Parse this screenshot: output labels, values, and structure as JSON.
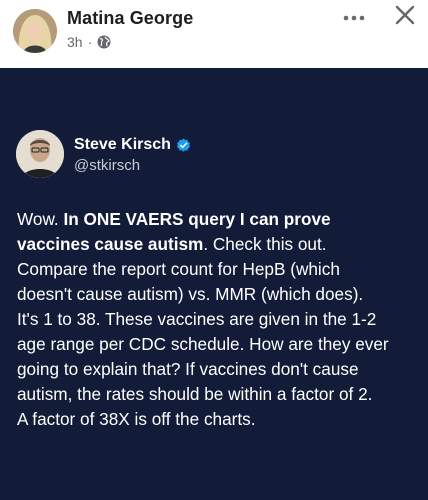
{
  "post": {
    "author_name": "Matina George",
    "time": "3h",
    "separator": "·",
    "audience_icon": "globe-icon",
    "more_icon": "more-icon",
    "close_icon": "close-icon"
  },
  "shared_tweet": {
    "name": "Steve Kirsch",
    "handle": "@stkirsch",
    "verified_icon": "verified-badge-icon",
    "text_lines": [
      {
        "plain": "Wow. ",
        "bold": "In ONE VAERS query I can prove"
      },
      {
        "bold": "vaccines cause autism",
        "plain": ".  Check this out."
      },
      {
        "plain": "Compare the report count for HepB (which"
      },
      {
        "plain": "doesn't cause autism) vs. MMR (which does)."
      },
      {
        "plain": "It's 1 to 38. These vaccines are given in the 1-2"
      },
      {
        "plain": "age range per CDC schedule. How are they ever"
      },
      {
        "plain": "going to explain that? If vaccines don't cause"
      },
      {
        "plain": "autism, the rates should be within a factor of 2."
      },
      {
        "plain": "A factor of 38X is off the charts."
      }
    ]
  },
  "colors": {
    "card_background": "#121b37",
    "verified_blue": "#1d9bf0",
    "meta_gray": "#65676b"
  }
}
